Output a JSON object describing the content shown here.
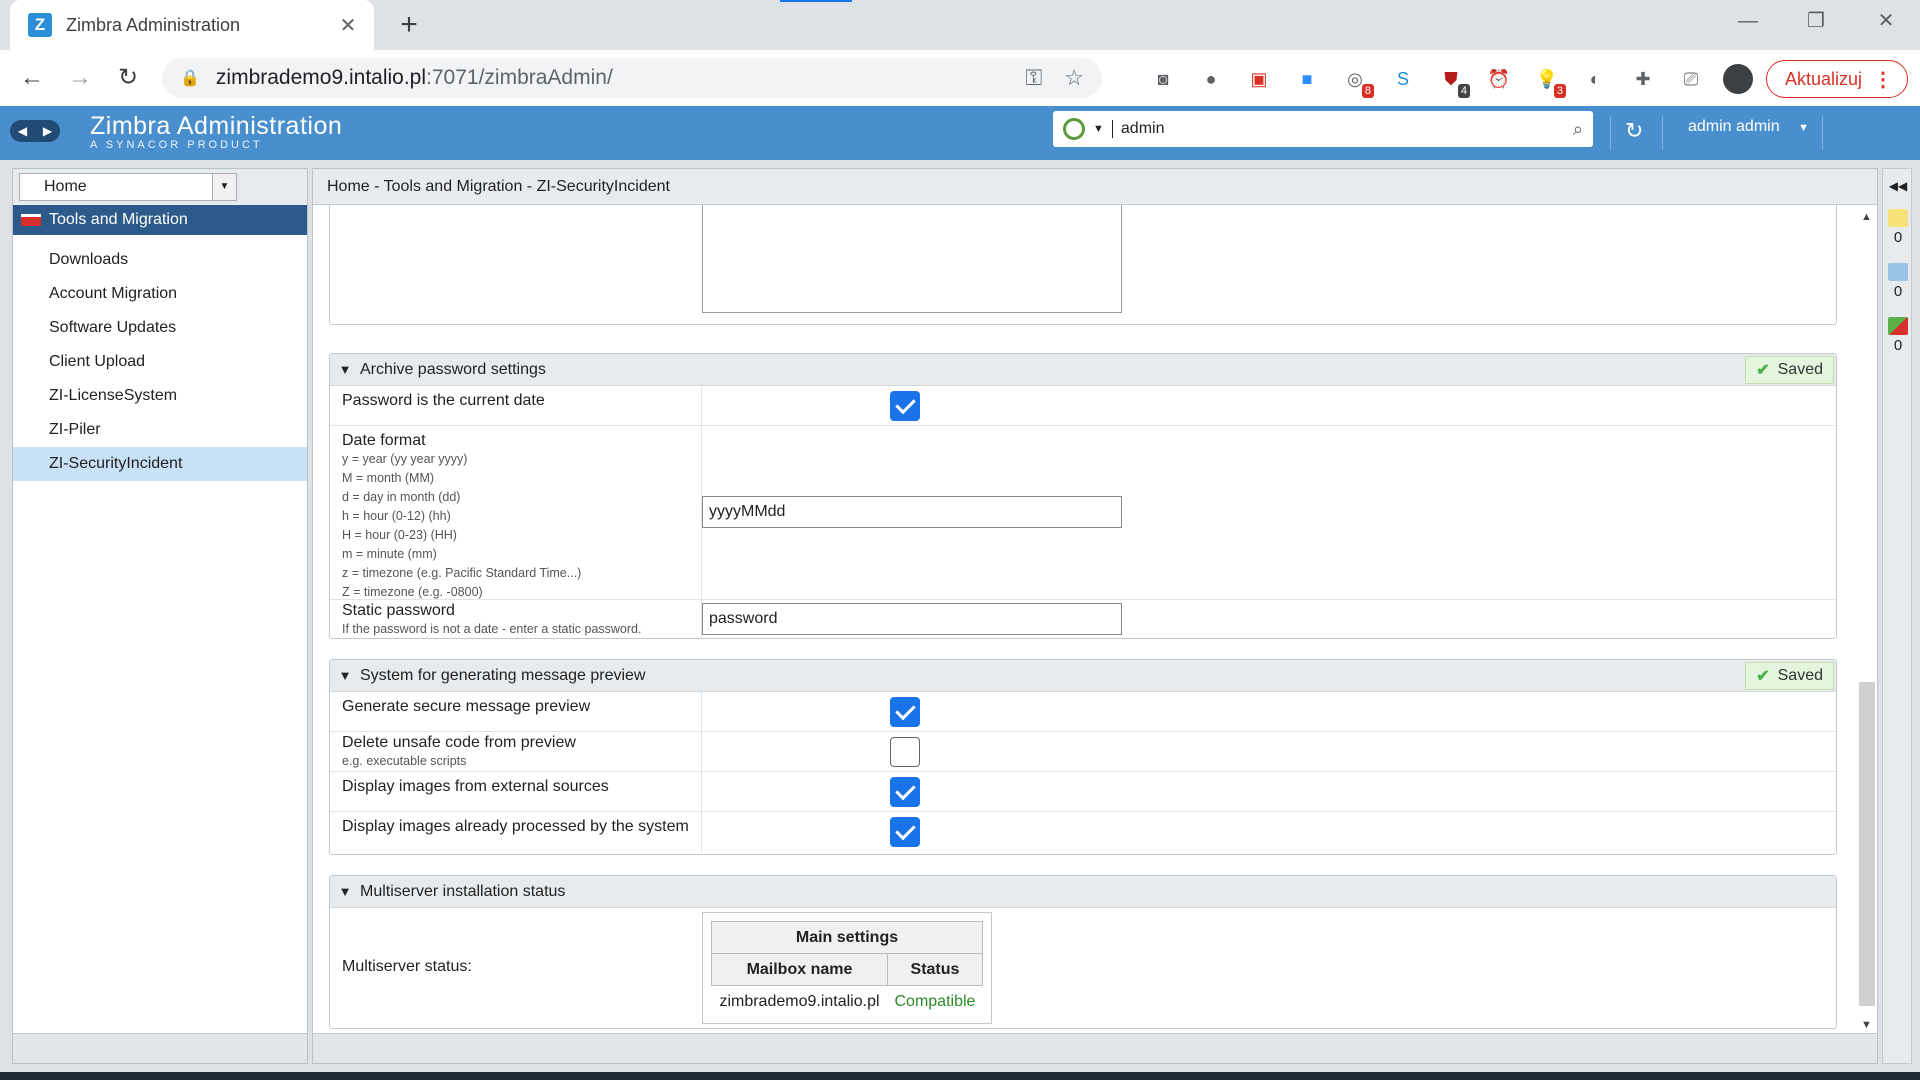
{
  "browser": {
    "tab_title": "Zimbra Administration",
    "tab_close": "✕",
    "new_tab": "+",
    "url_host": "zimbrademo9.intalio.pl",
    "url_path": ":7071/zimbraAdmin/",
    "update_label": "Aktualizuj",
    "ext_badges": [
      "8",
      "4",
      "3"
    ]
  },
  "header": {
    "logo_title": "Zimbra Administration",
    "logo_subtitle": "A SYNACOR PRODUCT",
    "search_value": "admin",
    "user_label": "admin admin"
  },
  "nav": {
    "home_label": "Home",
    "section_label": "Tools and Migration",
    "items": [
      {
        "label": "Downloads"
      },
      {
        "label": "Account Migration"
      },
      {
        "label": "Software Updates"
      },
      {
        "label": "Client Upload"
      },
      {
        "label": "ZI-LicenseSystem"
      },
      {
        "label": "ZI-Piler"
      },
      {
        "label": "ZI-SecurityIncident"
      }
    ]
  },
  "main": {
    "breadcrumb": "Home - Tools and Migration - ZI-SecurityIncident",
    "saved_label": "Saved",
    "archive": {
      "title": "Archive password settings",
      "password_current_date_label": "Password is the current date",
      "password_current_date_checked": true,
      "date_format_label": "Date format",
      "date_format_help": [
        "y = year (yy year yyyy)",
        "M = month (MM)",
        "d = day in month (dd)",
        "h = hour (0-12) (hh)",
        "H = hour (0-23) (HH)",
        "m = minute (mm)",
        "z = timezone (e.g. Pacific Standard Time...)",
        "Z = timezone (e.g. -0800)"
      ],
      "date_format_value": "yyyyMMdd",
      "static_password_label": "Static password",
      "static_password_help": "If the password is not a date - enter a static password.",
      "static_password_value": "password"
    },
    "preview": {
      "title": "System for generating message preview",
      "generate_label": "Generate secure message preview",
      "generate_checked": true,
      "delete_unsafe_label": "Delete unsafe code from preview",
      "delete_unsafe_help": "e.g. executable scripts",
      "delete_unsafe_checked": false,
      "external_images_label": "Display images from external sources",
      "external_images_checked": true,
      "processed_images_label": "Display images already processed by the system",
      "processed_images_checked": true
    },
    "multiserver": {
      "title": "Multiserver installation status",
      "status_label": "Multiserver status:",
      "table_title": "Main settings",
      "col_mailbox": "Mailbox name",
      "col_status": "Status",
      "rows": [
        {
          "mailbox": "zimbrademo9.intalio.pl",
          "status": "Compatible"
        }
      ]
    }
  },
  "rightpanel": {
    "counts": [
      "0",
      "0",
      "0"
    ]
  },
  "colors": {
    "zimbra_blue": "#4a8fcd",
    "nav_active_header": "#2c5a8a",
    "checkbox_blue": "#1a73e8",
    "compatible_green": "#2a8a2a",
    "update_red": "#d93025"
  }
}
